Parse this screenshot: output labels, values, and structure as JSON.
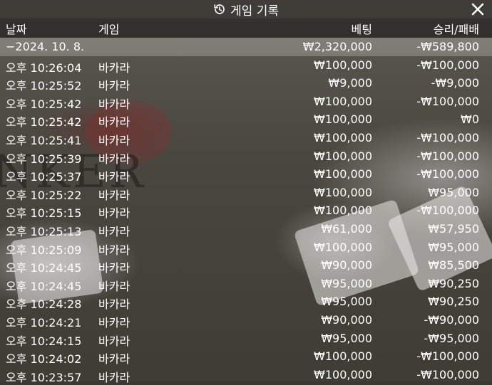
{
  "title": "게임 기록",
  "header": {
    "date": "날짜",
    "game": "게임",
    "bet": "베팅",
    "result": "승리/패배"
  },
  "summary": {
    "date": "−2024. 10. 8.",
    "game": "",
    "bet": "₩2,320,000",
    "result": "-₩589,800"
  },
  "rows": [
    {
      "time": "오후 10:26:04",
      "game": "바카라",
      "bet": "₩100,000",
      "result": "-₩100,000"
    },
    {
      "time": "오후 10:25:52",
      "game": "바카라",
      "bet": "₩9,000",
      "result": "-₩9,000"
    },
    {
      "time": "오후 10:25:42",
      "game": "바카라",
      "bet": "₩100,000",
      "result": "-₩100,000"
    },
    {
      "time": "오후 10:25:42",
      "game": "바카라",
      "bet": "₩100,000",
      "result": "₩0"
    },
    {
      "time": "오후 10:25:41",
      "game": "바카라",
      "bet": "₩100,000",
      "result": "-₩100,000"
    },
    {
      "time": "오후 10:25:39",
      "game": "바카라",
      "bet": "₩100,000",
      "result": "-₩100,000"
    },
    {
      "time": "오후 10:25:37",
      "game": "바카라",
      "bet": "₩100,000",
      "result": "-₩100,000"
    },
    {
      "time": "오후 10:25:22",
      "game": "바카라",
      "bet": "₩100,000",
      "result": "₩95,000"
    },
    {
      "time": "오후 10:25:15",
      "game": "바카라",
      "bet": "₩100,000",
      "result": "-₩100,000"
    },
    {
      "time": "오후 10:25:13",
      "game": "바카라",
      "bet": "₩61,000",
      "result": "₩57,950"
    },
    {
      "time": "오후 10:25:09",
      "game": "바카라",
      "bet": "₩100,000",
      "result": "₩95,000"
    },
    {
      "time": "오후 10:24:45",
      "game": "바카라",
      "bet": "₩90,000",
      "result": "₩85,500"
    },
    {
      "time": "오후 10:24:45",
      "game": "바카라",
      "bet": "₩95,000",
      "result": "₩90,250"
    },
    {
      "time": "오후 10:24:28",
      "game": "바카라",
      "bet": "₩95,000",
      "result": "₩90,250"
    },
    {
      "time": "오후 10:24:21",
      "game": "바카라",
      "bet": "₩90,000",
      "result": "-₩90,000"
    },
    {
      "time": "오후 10:24:15",
      "game": "바카라",
      "bet": "₩95,000",
      "result": "-₩95,000"
    },
    {
      "time": "오후 10:24:02",
      "game": "바카라",
      "bet": "₩100,000",
      "result": "-₩100,000"
    },
    {
      "time": "오후 10:23:57",
      "game": "바카라",
      "bet": "₩100,000",
      "result": "-₩100,000"
    }
  ],
  "background_word": "NKER",
  "icons": {
    "history": "history-icon",
    "close": "close-icon"
  }
}
